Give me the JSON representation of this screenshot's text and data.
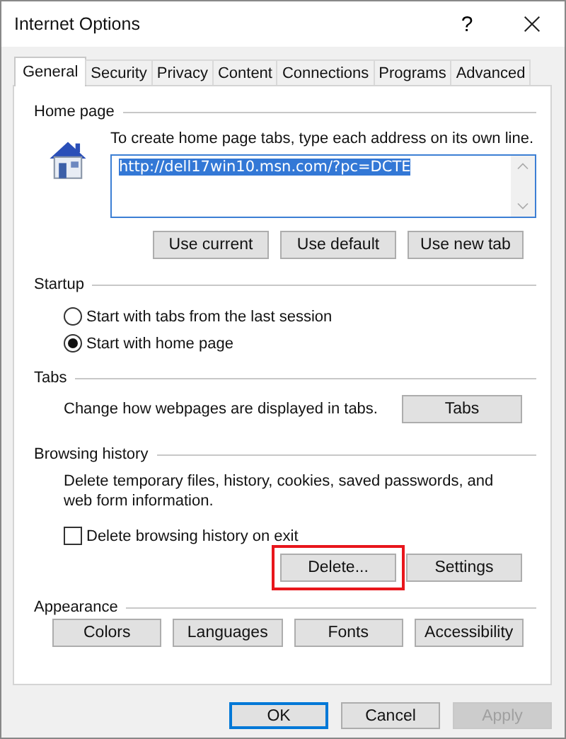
{
  "window": {
    "title": "Internet Options",
    "help": "?"
  },
  "tabs": [
    {
      "label": "General",
      "selected": true
    },
    {
      "label": "Security",
      "selected": false
    },
    {
      "label": "Privacy",
      "selected": false
    },
    {
      "label": "Content",
      "selected": false
    },
    {
      "label": "Connections",
      "selected": false
    },
    {
      "label": "Programs",
      "selected": false
    },
    {
      "label": "Advanced",
      "selected": false
    }
  ],
  "home_page": {
    "heading": "Home page",
    "instruction": "To create home page tabs, type each address on its own line.",
    "address": {
      "value": "http://dell17win10.msn.com/?pc=DCTE",
      "selected": true
    },
    "buttons": [
      "Use current",
      "Use default",
      "Use new tab"
    ]
  },
  "startup": {
    "heading": "Startup",
    "options": [
      {
        "label": "Start with tabs from the last session",
        "selected": false
      },
      {
        "label": "Start with home page",
        "selected": true
      }
    ]
  },
  "tabs_section": {
    "heading": "Tabs",
    "description": "Change how webpages are displayed in tabs.",
    "button": "Tabs"
  },
  "browsing_history": {
    "heading": "Browsing history",
    "description": "Delete temporary files, history, cookies, saved passwords, and web form information.",
    "option": {
      "label": "Delete browsing history on exit",
      "checked": false
    },
    "buttons": [
      {
        "label": "Delete...",
        "highlighted": true
      },
      {
        "label": "Settings",
        "highlighted": false
      }
    ]
  },
  "appearance": {
    "heading": "Appearance",
    "buttons": [
      "Colors",
      "Languages",
      "Fonts",
      "Accessibility"
    ]
  },
  "footer": [
    {
      "label": "OK",
      "default": true,
      "disabled": false
    },
    {
      "label": "Cancel",
      "default": false,
      "disabled": false
    },
    {
      "label": "Apply",
      "default": false,
      "disabled": true
    }
  ]
}
